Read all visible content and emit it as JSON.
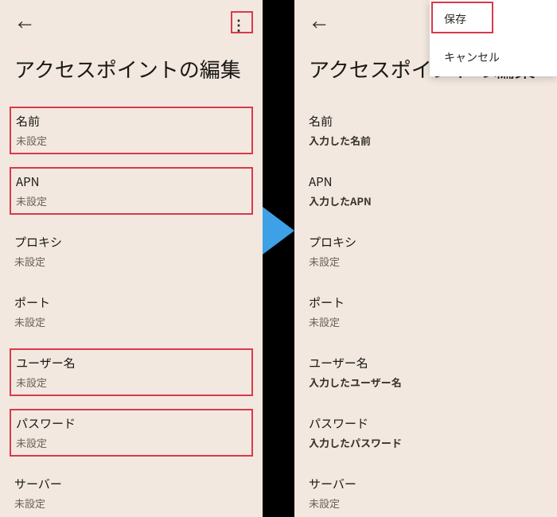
{
  "left": {
    "page_title": "アクセスポイントの編集",
    "fields": [
      {
        "label": "名前",
        "value": "未設定",
        "highlighted": true
      },
      {
        "label": "APN",
        "value": "未設定",
        "highlighted": true
      },
      {
        "label": "プロキシ",
        "value": "未設定",
        "highlighted": false
      },
      {
        "label": "ポート",
        "value": "未設定",
        "highlighted": false
      },
      {
        "label": "ユーザー名",
        "value": "未設定",
        "highlighted": true
      },
      {
        "label": "パスワード",
        "value": "未設定",
        "highlighted": true
      },
      {
        "label": "サーバー",
        "value": "未設定",
        "highlighted": false
      }
    ]
  },
  "right": {
    "page_title": "アクセスポイントの編集",
    "menu": {
      "save": "保存",
      "cancel": "キャンセル"
    },
    "fields": [
      {
        "label": "名前",
        "value": "入力した名前",
        "filled": true
      },
      {
        "label": "APN",
        "value": "入力したAPN",
        "filled": true
      },
      {
        "label": "プロキシ",
        "value": "未設定",
        "filled": false
      },
      {
        "label": "ポート",
        "value": "未設定",
        "filled": false
      },
      {
        "label": "ユーザー名",
        "value": "入力したユーザー名",
        "filled": true
      },
      {
        "label": "パスワード",
        "value": "入力したパスワード",
        "filled": true
      },
      {
        "label": "サーバー",
        "value": "未設定",
        "filled": false
      }
    ]
  }
}
